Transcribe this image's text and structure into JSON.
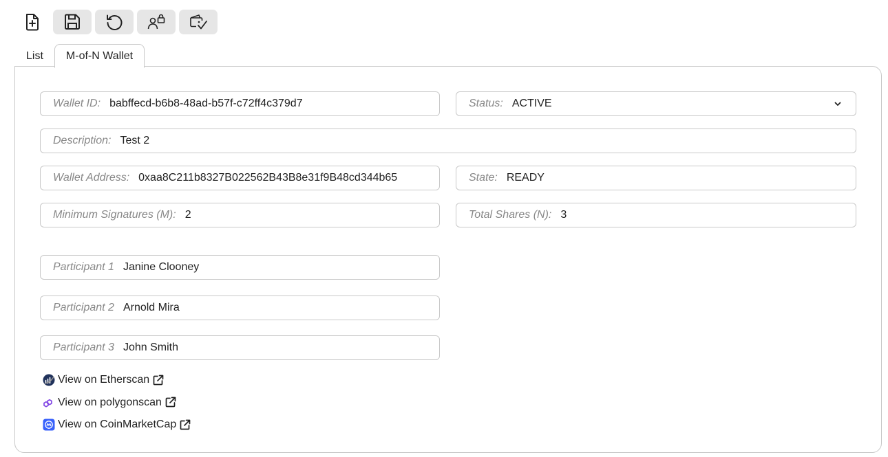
{
  "toolbar": {
    "buttons": [
      {
        "icon": "new-document-icon"
      },
      {
        "icon": "save-icon"
      },
      {
        "icon": "refresh-icon"
      },
      {
        "icon": "user-lock-icon"
      },
      {
        "icon": "wallet-check-icon"
      }
    ]
  },
  "tabs": [
    {
      "label": "List",
      "active": false
    },
    {
      "label": "M-of-N Wallet",
      "active": true
    }
  ],
  "form": {
    "wallet_id": {
      "label": "Wallet ID:",
      "value": "babffecd-b6b8-48ad-b57f-c72ff4c379d7"
    },
    "status": {
      "label": "Status:",
      "value": "ACTIVE"
    },
    "description": {
      "label": "Description:",
      "value": "Test 2"
    },
    "wallet_address": {
      "label": "Wallet Address:",
      "value": "0xaa8C211b8327B022562B43B8e31f9B48cd344b65"
    },
    "state": {
      "label": "State:",
      "value": "READY"
    },
    "min_signatures": {
      "label": "Minimum Signatures (M):",
      "value": "2"
    },
    "total_shares": {
      "label": "Total Shares (N):",
      "value": "3"
    },
    "participants": [
      {
        "label": "Participant 1",
        "value": "Janine Clooney"
      },
      {
        "label": "Participant 2",
        "value": "Arnold Mira"
      },
      {
        "label": "Participant 3",
        "value": "John Smith"
      }
    ]
  },
  "links": [
    {
      "label": "View on Etherscan",
      "icon": "etherscan-logo-icon"
    },
    {
      "label": "View on polygonscan",
      "icon": "polygon-logo-icon"
    },
    {
      "label": "View on CoinMarketCap",
      "icon": "coinmarketcap-logo-icon"
    }
  ],
  "colors": {
    "border": "#c8c8c8",
    "button_bg": "#e6e6e6",
    "label": "#888888",
    "polygon": "#8247e5",
    "coinmarketcap": "#3861fb",
    "etherscan": "#21325b"
  }
}
